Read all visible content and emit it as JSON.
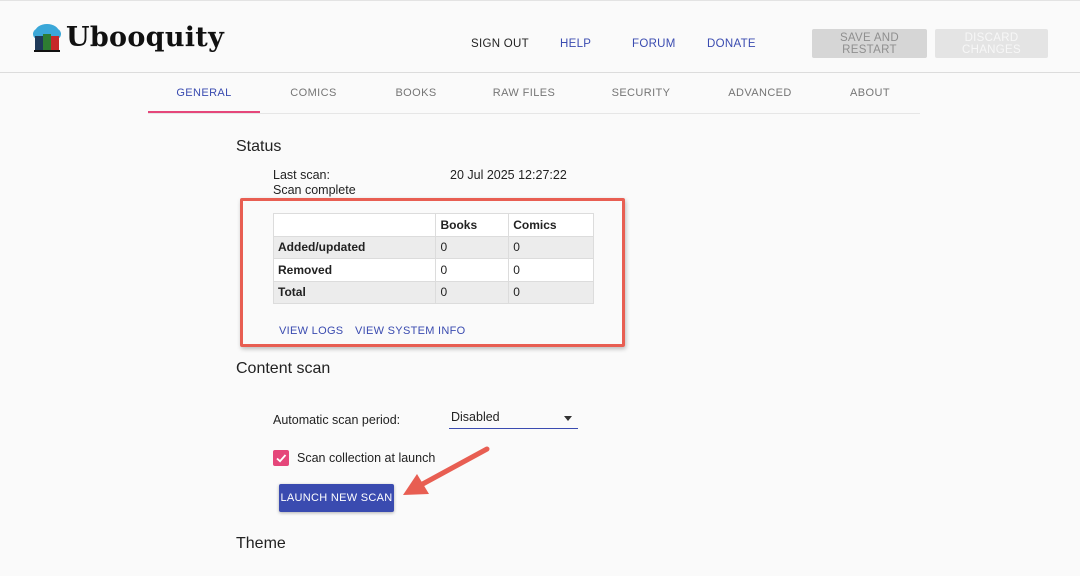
{
  "app": {
    "name": "Ubooquity"
  },
  "nav": {
    "sign_out": "SIGN OUT",
    "help": "HELP",
    "forum": "FORUM",
    "donate": "DONATE",
    "save_restart": "SAVE AND RESTART",
    "discard": "DISCARD CHANGES"
  },
  "tabs": [
    {
      "label": "GENERAL",
      "active": true
    },
    {
      "label": "COMICS"
    },
    {
      "label": "BOOKS"
    },
    {
      "label": "RAW FILES"
    },
    {
      "label": "SECURITY"
    },
    {
      "label": "ADVANCED"
    },
    {
      "label": "ABOUT"
    }
  ],
  "status": {
    "heading": "Status",
    "last_scan_label": "Last scan:",
    "last_scan_value": "20 Jul 2025 12:27:22",
    "scan_state": "Scan complete",
    "table": {
      "headers": [
        "",
        "Books",
        "Comics"
      ],
      "rows": [
        {
          "label": "Added/updated",
          "books": "0",
          "comics": "0"
        },
        {
          "label": "Removed",
          "books": "0",
          "comics": "0"
        },
        {
          "label": "Total",
          "books": "0",
          "comics": "0"
        }
      ]
    },
    "view_logs": "VIEW LOGS",
    "view_system_info": "VIEW SYSTEM INFO"
  },
  "content_scan": {
    "heading": "Content scan",
    "period_label": "Automatic scan period:",
    "period_value": "Disabled",
    "scan_at_launch_label": "Scan collection at launch",
    "scan_at_launch_checked": true,
    "launch_button": "LAUNCH NEW SCAN"
  },
  "theme": {
    "heading": "Theme"
  },
  "colors": {
    "primary": "#3a4bb0",
    "accent": "#e5467a",
    "annotation": "#e85e52"
  }
}
